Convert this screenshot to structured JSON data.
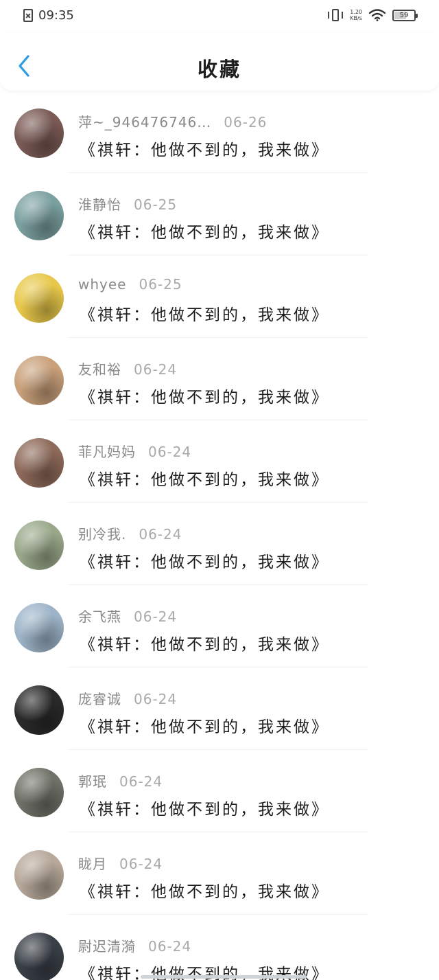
{
  "status_bar": {
    "time": "09:35",
    "net_speed_value": "1.20",
    "net_speed_unit": "KB/s",
    "battery_level": "59"
  },
  "header": {
    "title": "收藏"
  },
  "favorites": [
    {
      "author": "萍~_946476746…",
      "date": "06-26",
      "title": "《祺轩：他做不到的，我来做》"
    },
    {
      "author": "淮静怡",
      "date": "06-25",
      "title": "《祺轩：他做不到的，我来做》"
    },
    {
      "author": "whyee",
      "date": "06-25",
      "title": "《祺轩：他做不到的，我来做》"
    },
    {
      "author": "友和裕",
      "date": "06-24",
      "title": "《祺轩：他做不到的，我来做》"
    },
    {
      "author": "菲凡妈妈",
      "date": "06-24",
      "title": "《祺轩：他做不到的，我来做》"
    },
    {
      "author": "别冷我.",
      "date": "06-24",
      "title": "《祺轩：他做不到的，我来做》"
    },
    {
      "author": "余飞燕",
      "date": "06-24",
      "title": "《祺轩：他做不到的，我来做》"
    },
    {
      "author": "庞睿诚",
      "date": "06-24",
      "title": "《祺轩：他做不到的，我来做》"
    },
    {
      "author": "郭珉",
      "date": "06-24",
      "title": "《祺轩：他做不到的，我来做》"
    },
    {
      "author": "眬月",
      "date": "06-24",
      "title": "《祺轩：他做不到的，我来做》"
    },
    {
      "author": "尉迟清漪",
      "date": "06-24",
      "title": "《祺轩：他做不到的，我来做》"
    }
  ],
  "colors": {
    "accent": "#2b9be6",
    "text_primary": "#1e1e1e",
    "text_secondary": "#8a8a8a",
    "avatars": [
      "#7a5a55",
      "#7ba0a0",
      "#e8c84a",
      "#c9a07a",
      "#8e6a5a",
      "#9aa88a",
      "#9db4c8",
      "#2a2a2a",
      "#6f7268",
      "#b7a89a",
      "#3a4048"
    ]
  },
  "icons": {
    "back": "chevron-left-icon",
    "sim": "no-sim-icon",
    "vibrate": "vibrate-icon",
    "wifi": "wifi-icon",
    "battery": "battery-icon"
  }
}
